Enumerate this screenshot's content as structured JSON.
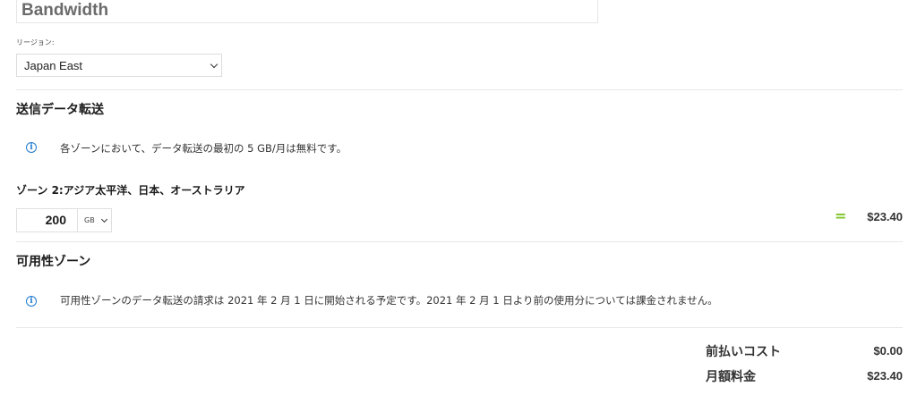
{
  "header": {
    "title": "Bandwidth"
  },
  "region": {
    "label": "リージョン:",
    "selected": "Japan East"
  },
  "outbound": {
    "heading": "送信データ転送",
    "info": "各ゾーンにおいて、データ転送の最初の 5 GB/月は無料です。",
    "zone_label": "ゾーン 2:アジア太平洋、日本、オーストラリア",
    "quantity": "200",
    "unit": "GB",
    "equals": "=",
    "price": "$23.40"
  },
  "availability": {
    "heading": "可用性ゾーン",
    "info": "可用性ゾーンのデータ転送の請求は 2021 年 2 月 1 日に開始される予定です。2021 年 2 月 1 日より前の使用分については課金されません。"
  },
  "summary": {
    "upfront_label": "前払いコスト",
    "upfront_value": "$0.00",
    "monthly_label": "月額料金",
    "monthly_value": "$23.40"
  },
  "colors": {
    "accent_green": "#7cc424",
    "info_blue": "#1f7ad1"
  }
}
